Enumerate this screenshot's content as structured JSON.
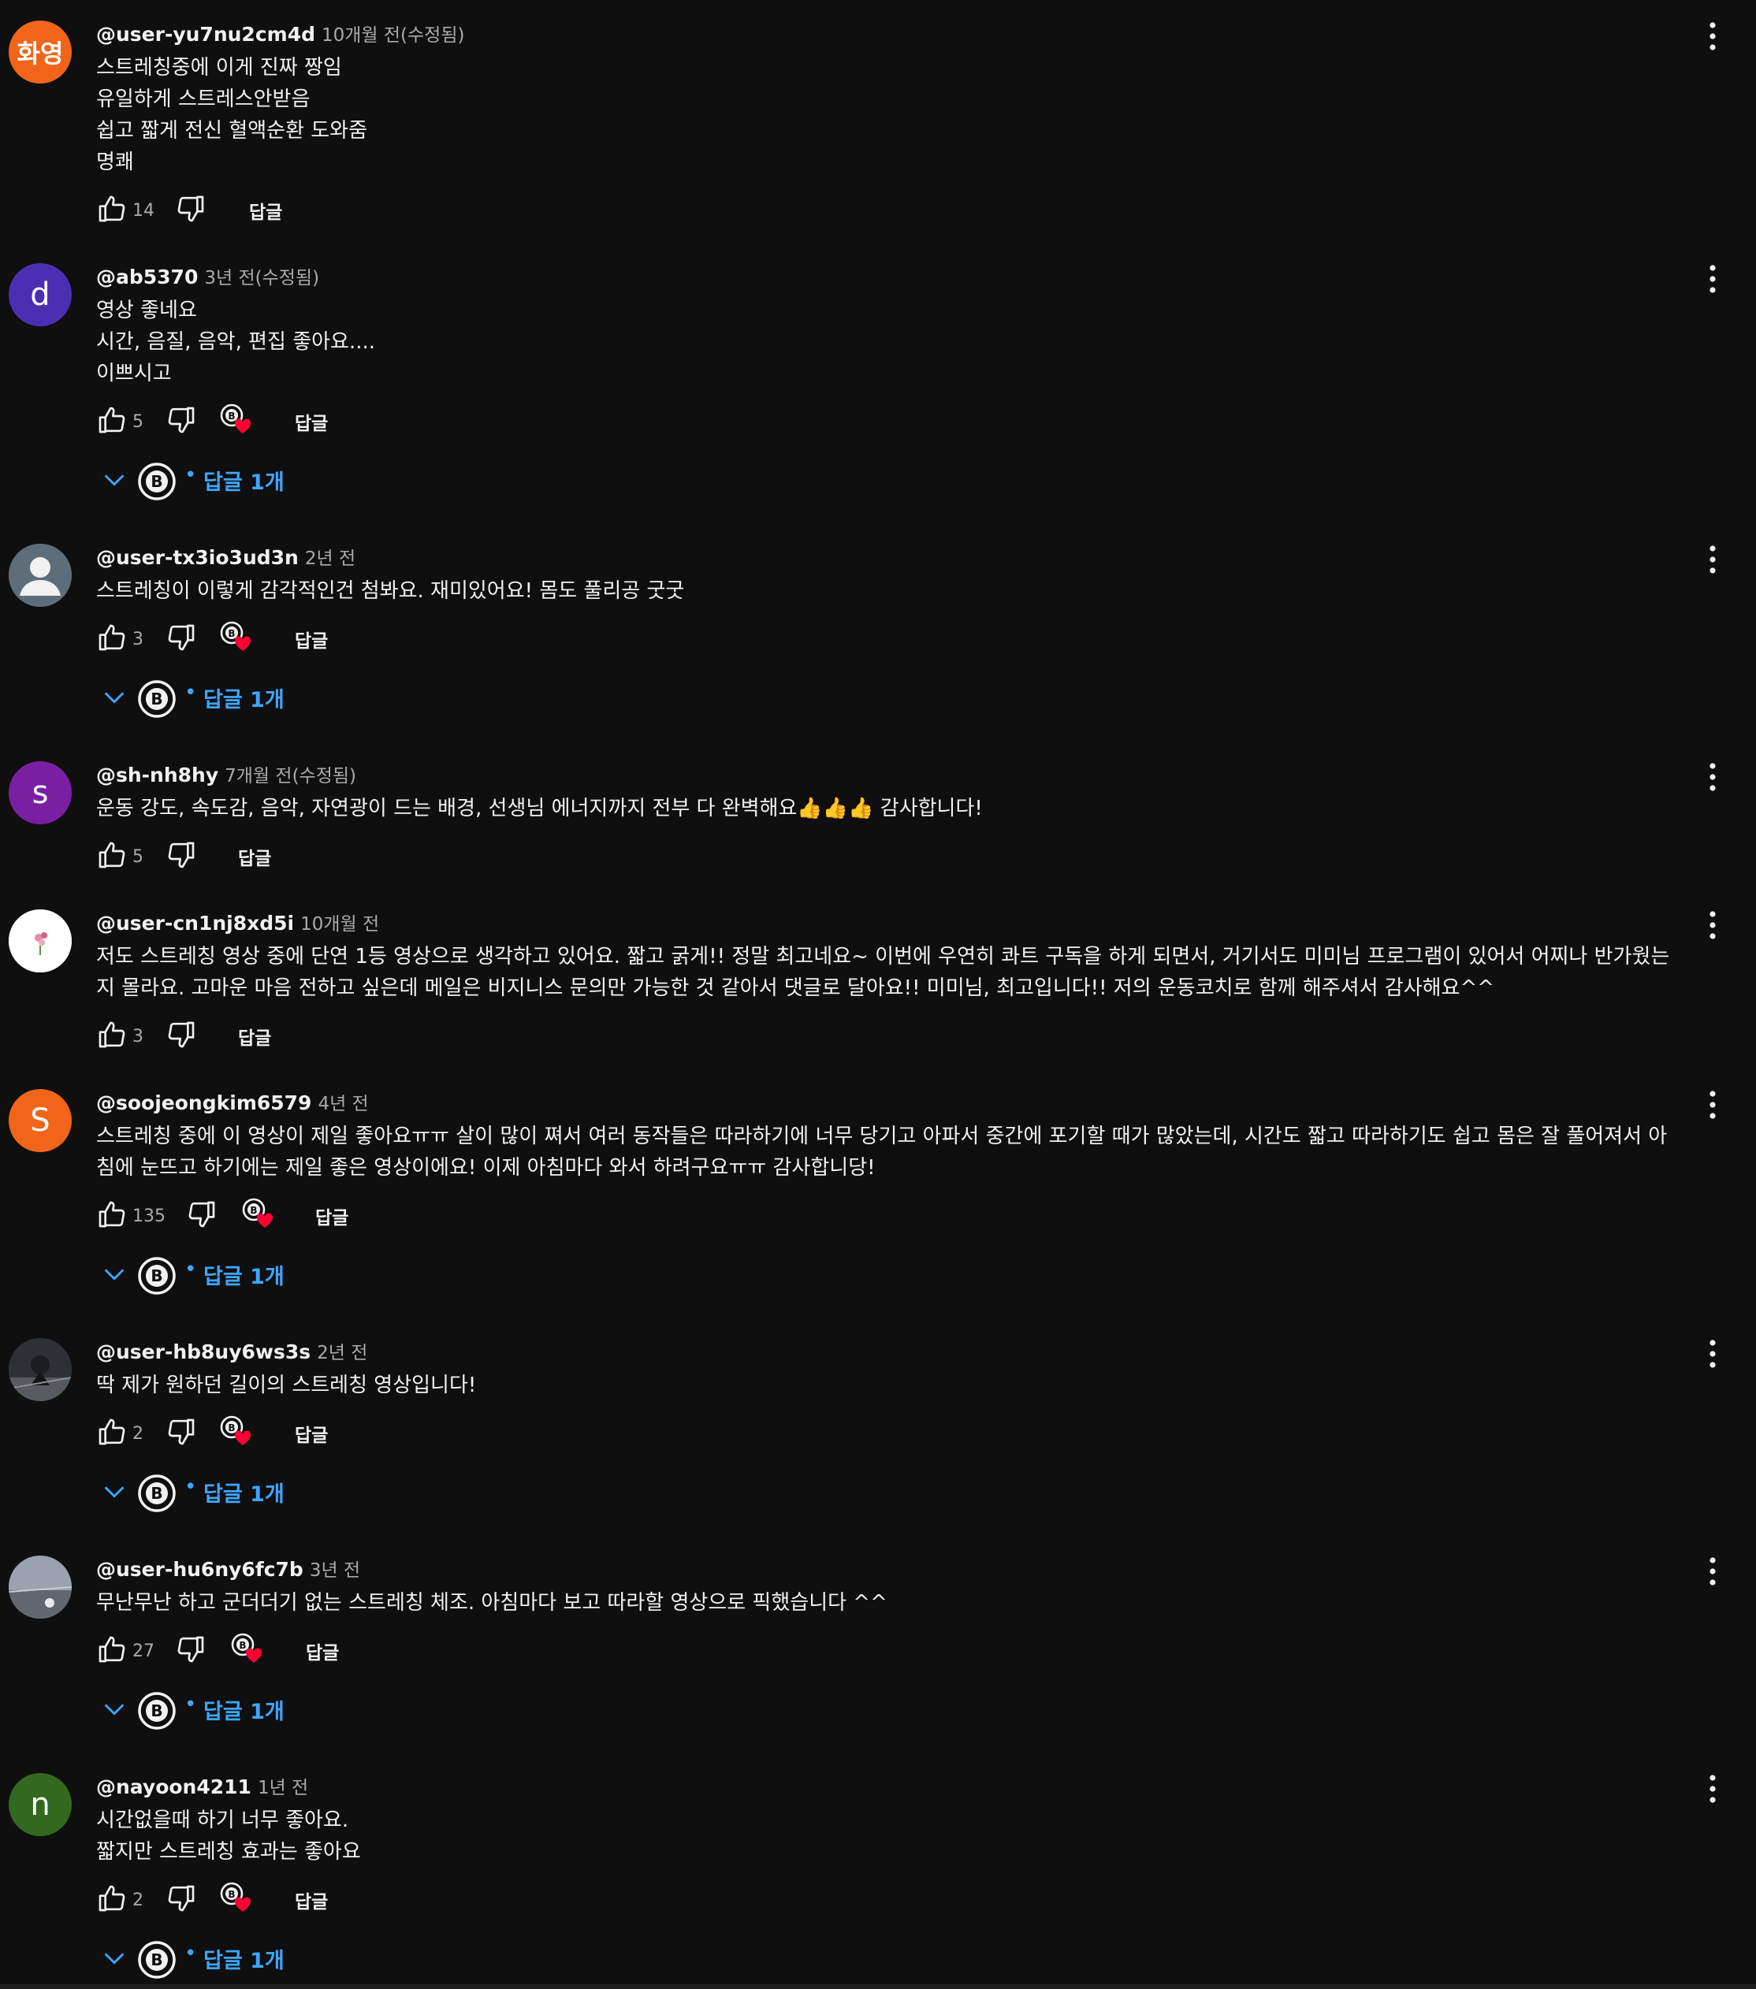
{
  "colors": {
    "background": "#0f0f0f",
    "text": "#f1f1f1",
    "secondary": "#aaaaaa",
    "link": "#3ea6ff",
    "heart": "#ff0033"
  },
  "comments": [
    {
      "author": "@user-yu7nu2cm4d",
      "time": "10개월 전(수정됨)",
      "text": "스트레칭중에 이게 진짜 짱임\n유일하게 스트레스안받음\n쉽고 짧게 전신 혈액순환 도와줌\n명쾌",
      "likes": "14",
      "reply_label": "답글",
      "avatar_text": "화영",
      "avatar_color": "#f0651a",
      "hearted": false,
      "replies_label": ""
    },
    {
      "author": "@ab5370",
      "time": "3년 전(수정됨)",
      "text": "영상 좋네요\n시간, 음질, 음악, 편집 좋아요....\n이쁘시고",
      "likes": "5",
      "reply_label": "답글",
      "avatar_text": "d",
      "avatar_color": "#4a2fb3",
      "hearted": true,
      "replies_label": "답글 1개"
    },
    {
      "author": "@user-tx3io3ud3n",
      "time": "2년 전",
      "text": "스트레칭이 이렇게 감각적인건 첨봐요. 재미있어요! 몸도 풀리공 굿굿",
      "likes": "3",
      "reply_label": "답글",
      "avatar_text": "",
      "avatar_color": "#5d6d7a",
      "hearted": true,
      "replies_label": "답글 1개"
    },
    {
      "author": "@sh-nh8hy",
      "time": "7개월 전(수정됨)",
      "text": "운동 강도, 속도감, 음악, 자연광이 드는 배경, 선생님 에너지까지 전부 다 완벽해요👍👍👍 감사합니다!",
      "likes": "5",
      "reply_label": "답글",
      "avatar_text": "s",
      "avatar_color": "#7b1fa2",
      "hearted": false,
      "replies_label": ""
    },
    {
      "author": "@user-cn1nj8xd5i",
      "time": "10개월 전",
      "text": "저도 스트레칭 영상 중에 단연 1등 영상으로 생각하고 있어요. 짧고 굵게!! 정말 최고네요~ 이번에 우연히 콰트 구독을 하게 되면서, 거기서도 미미님 프로그램이 있어서 어찌나 반가웠는지 몰라요. 고마운 마음 전하고 싶은데 메일은 비지니스 문의만 가능한 것 같아서 댓글로 달아요!! 미미님, 최고입니다!! 저의 운동코치로 함께 해주셔서 감사해요^^",
      "likes": "3",
      "reply_label": "답글",
      "avatar_text": "",
      "avatar_color": "#ffffff",
      "hearted": false,
      "replies_label": ""
    },
    {
      "author": "@soojeongkim6579",
      "time": "4년 전",
      "text": "스트레칭 중에 이 영상이 제일 좋아요ㅠㅠ 살이 많이 쪄서 여러 동작들은 따라하기에 너무 당기고 아파서 중간에 포기할 때가 많았는데, 시간도 짧고 따라하기도 쉽고 몸은 잘 풀어져서 아침에 눈뜨고 하기에는 제일 좋은 영상이에요! 이제 아침마다 와서 하려구요ㅠㅠ 감사합니당!",
      "likes": "135",
      "reply_label": "답글",
      "avatar_text": "S",
      "avatar_color": "#f0651a",
      "hearted": true,
      "replies_label": "답글 1개"
    },
    {
      "author": "@user-hb8uy6ws3s",
      "time": "2년 전",
      "text": "딱 제가 원하던 길이의 스트레칭 영상입니다!",
      "likes": "2",
      "reply_label": "답글",
      "avatar_text": "",
      "avatar_color": "#3a3f45",
      "hearted": true,
      "replies_label": "답글 1개"
    },
    {
      "author": "@user-hu6ny6fc7b",
      "time": "3년 전",
      "text": "무난무난 하고 군더더기 없는 스트레칭 체조. 아침마다 보고 따라할 영상으로 픽했습니다 ^^",
      "likes": "27",
      "reply_label": "답글",
      "avatar_text": "",
      "avatar_color": "#6b7480",
      "hearted": true,
      "replies_label": "답글 1개"
    },
    {
      "author": "@nayoon4211",
      "time": "1년 전",
      "text": "시간없을때 하기 너무 좋아요.\n짧지만 스트레칭 효과는 좋아요",
      "likes": "2",
      "reply_label": "답글",
      "avatar_text": "n",
      "avatar_color": "#33691e",
      "hearted": true,
      "replies_label": "답글 1개"
    }
  ]
}
